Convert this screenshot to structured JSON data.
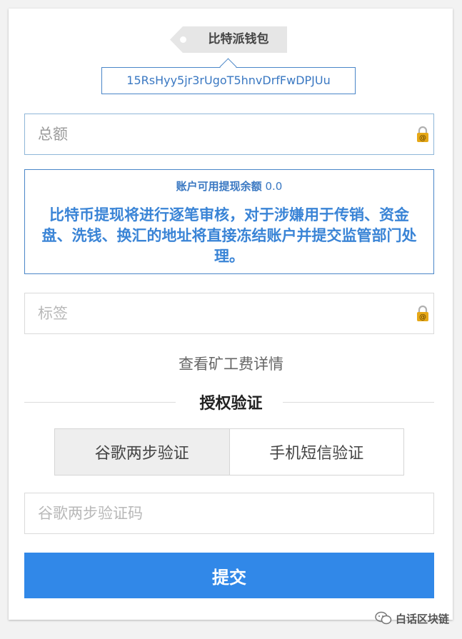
{
  "wallet": {
    "name": "比特派钱包",
    "address": "15RsHyy5jr3rUgoT5hnvDrfFwDPJUu"
  },
  "amount_field": {
    "placeholder": "总额"
  },
  "info": {
    "balance_label": "账户可用提现余额",
    "balance_value": "0.0",
    "notice": "比特币提现将进行逐笔审核，对于涉嫌用于传销、资金盘、洗钱、换汇的地址将直接冻结账户并提交监管部门处理。"
  },
  "label_field": {
    "placeholder": "标签"
  },
  "fee_link": "查看矿工费详情",
  "auth": {
    "title": "授权验证",
    "tabs": [
      {
        "label": "谷歌两步验证",
        "active": true
      },
      {
        "label": "手机短信验证",
        "active": false
      }
    ],
    "code_placeholder": "谷歌两步验证码"
  },
  "submit_label": "提交",
  "watermark": "白话区块链",
  "colors": {
    "accent": "#3188e8",
    "link_blue": "#3a78c2",
    "lock_gold": "#e6a817"
  }
}
